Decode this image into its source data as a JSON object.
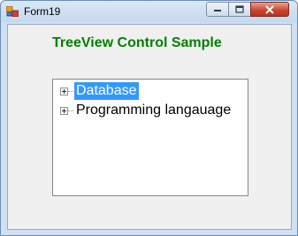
{
  "window": {
    "title": "Form19"
  },
  "main": {
    "heading": "TreeView Control Sample",
    "tree": {
      "nodes": [
        {
          "label": "Database",
          "selected": true,
          "expander": "plus"
        },
        {
          "label": "Programming langauage",
          "selected": false,
          "expander": "plus"
        }
      ]
    }
  },
  "icons": {
    "app": "form-app-icon",
    "minimize": "minimize-icon",
    "maximize": "maximize-icon",
    "close": "close-icon",
    "expand": "plus-box-icon"
  },
  "colors": {
    "heading": "#008000",
    "selection": "#3399ff",
    "close_button": "#c8432a"
  }
}
